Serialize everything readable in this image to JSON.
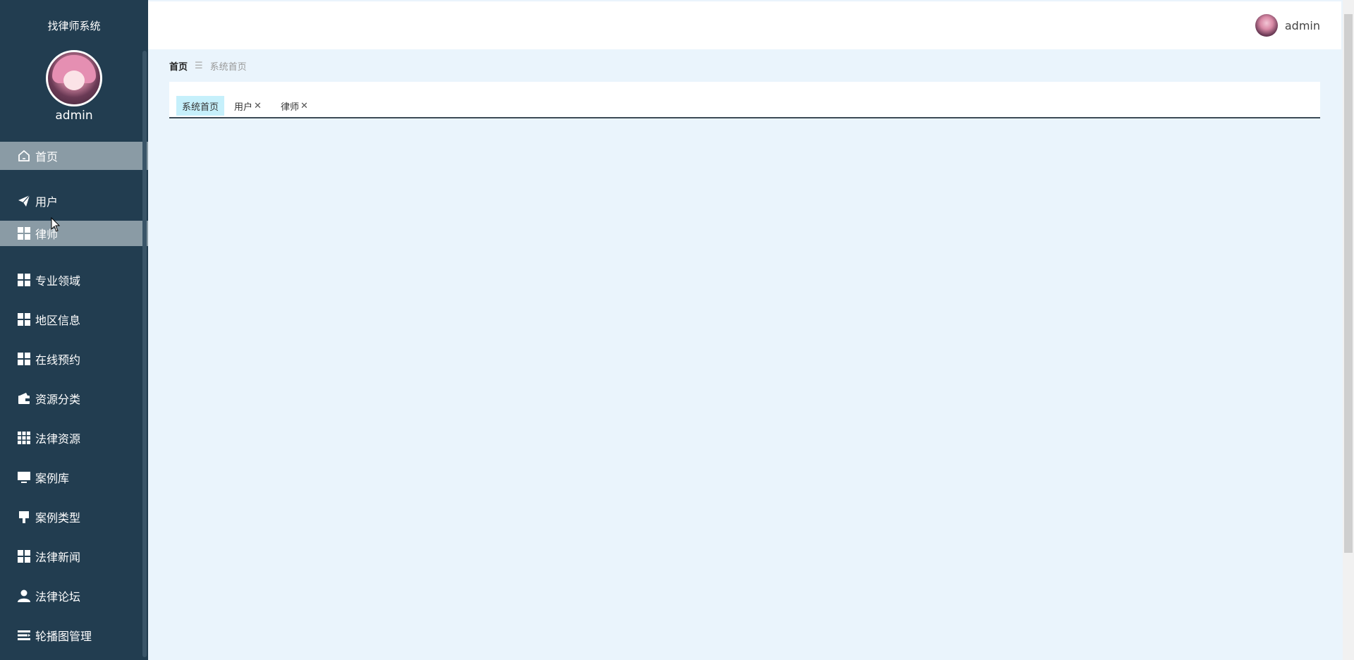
{
  "sidebar": {
    "system_title": "找律师系统",
    "user_name": "admin",
    "items": [
      {
        "label": "首页",
        "icon": "home-icon"
      },
      {
        "label": "用户",
        "icon": "paper-plane-icon"
      },
      {
        "label": "律师",
        "icon": "grid-icon"
      },
      {
        "label": "专业领域",
        "icon": "grid-icon"
      },
      {
        "label": "地区信息",
        "icon": "grid-icon"
      },
      {
        "label": "在线预约",
        "icon": "grid-icon"
      },
      {
        "label": "资源分类",
        "icon": "wallet-icon"
      },
      {
        "label": "法律资源",
        "icon": "grid-9-icon"
      },
      {
        "label": "案例库",
        "icon": "monitor-icon"
      },
      {
        "label": "案例类型",
        "icon": "brush-icon"
      },
      {
        "label": "法律新闻",
        "icon": "grid-icon"
      },
      {
        "label": "法律论坛",
        "icon": "user-icon"
      },
      {
        "label": "轮播图管理",
        "icon": "list-icon"
      }
    ]
  },
  "topbar": {
    "user_name": "admin"
  },
  "breadcrumb": {
    "home": "首页",
    "separator": "☰",
    "current": "系统首页"
  },
  "tabs": [
    {
      "label": "系统首页",
      "closable": false,
      "active": true
    },
    {
      "label": "用户",
      "closable": true,
      "active": false
    },
    {
      "label": "律师",
      "closable": true,
      "active": false
    }
  ],
  "colors": {
    "sidebar_bg": "#223d50",
    "active_item_bg": "#8a9ba5",
    "active_tab_bg": "#c6f0fb",
    "main_bg": "#eaf4fc"
  }
}
